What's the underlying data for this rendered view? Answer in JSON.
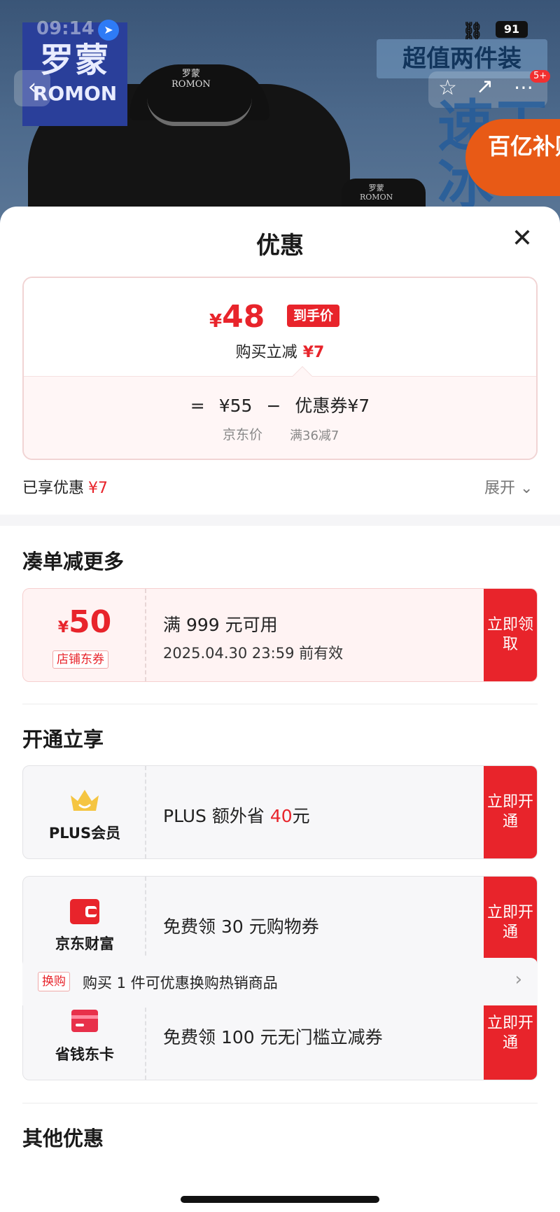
{
  "status_bar": {
    "time": "09:14",
    "battery": "91"
  },
  "hero": {
    "brand_cn": "罗蒙",
    "brand_en": "ROMON",
    "hanger_tag_cn": "罗蒙",
    "hanger_tag_en": "ROMON",
    "promo_banner": "超值两件装",
    "big_word": "速干冰",
    "subsidy": "百亿补贴",
    "cart_badge": "5+"
  },
  "sheet": {
    "title": "优惠",
    "price": {
      "currency": "¥",
      "amount": "48",
      "final_tag": "到手价",
      "instant_label": "购买立减",
      "instant_value": "¥7",
      "eq_sign": "=",
      "jd_price": "¥55",
      "minus_sign": "−",
      "coupon_part": "优惠券¥7",
      "jd_price_label": "京东价",
      "coupon_rule": "满36减7"
    },
    "enjoyed_label": "已享优惠",
    "enjoyed_value": "¥7",
    "expand_label": "展开"
  },
  "section_more": {
    "title": "凑单减更多",
    "coupon": {
      "currency": "¥",
      "amount": "50",
      "type": "店铺东券",
      "condition": "满 999 元可用",
      "validity": "2025.04.30 23:59 前有效",
      "cta": "立即领取"
    }
  },
  "section_open": {
    "title": "开通立享",
    "perks": [
      {
        "name": "PLUS会员",
        "desc_prefix": "PLUS 额外省 ",
        "desc_highlight": "40",
        "desc_suffix": "元",
        "cta": "立即开通"
      },
      {
        "name": "京东财富",
        "desc": "免费领 30 元购物券",
        "cta": "立即开通"
      },
      {
        "name": "省钱东卡",
        "desc": "免费领 100 元无门槛立减券",
        "cta": "立即开通"
      }
    ]
  },
  "section_other": {
    "title": "其他优惠",
    "tag": "换购",
    "text": "购买 1 件可优惠换购热销商品"
  },
  "colors": {
    "accent_red": "#e8242b",
    "plus_gold": "#f5c542"
  }
}
